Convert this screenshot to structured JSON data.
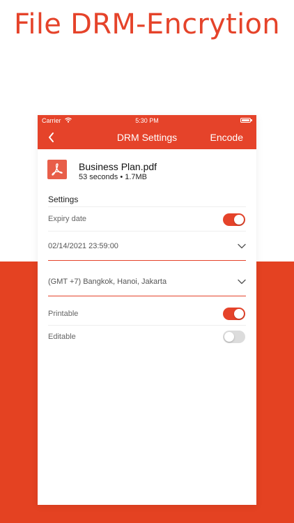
{
  "banner": {
    "title": "File DRM-Encrytion"
  },
  "status_bar": {
    "carrier": "Carrier",
    "time": "5:30 PM"
  },
  "nav": {
    "title": "DRM Settings",
    "encode_label": "Encode"
  },
  "file": {
    "name": "Business Plan.pdf",
    "meta": "53 seconds • 1.7MB"
  },
  "settings": {
    "section_title": "Settings",
    "expiry_label": "Expiry date",
    "expiry_on": true,
    "expiry_value": "02/14/2021 23:59:00",
    "timezone_value": "(GMT +7) Bangkok, Hanoi, Jakarta",
    "printable_label": "Printable",
    "printable_on": true,
    "editable_label": "Editable",
    "editable_on": false
  },
  "colors": {
    "accent": "#e5432a",
    "background_band": "#e44222"
  }
}
